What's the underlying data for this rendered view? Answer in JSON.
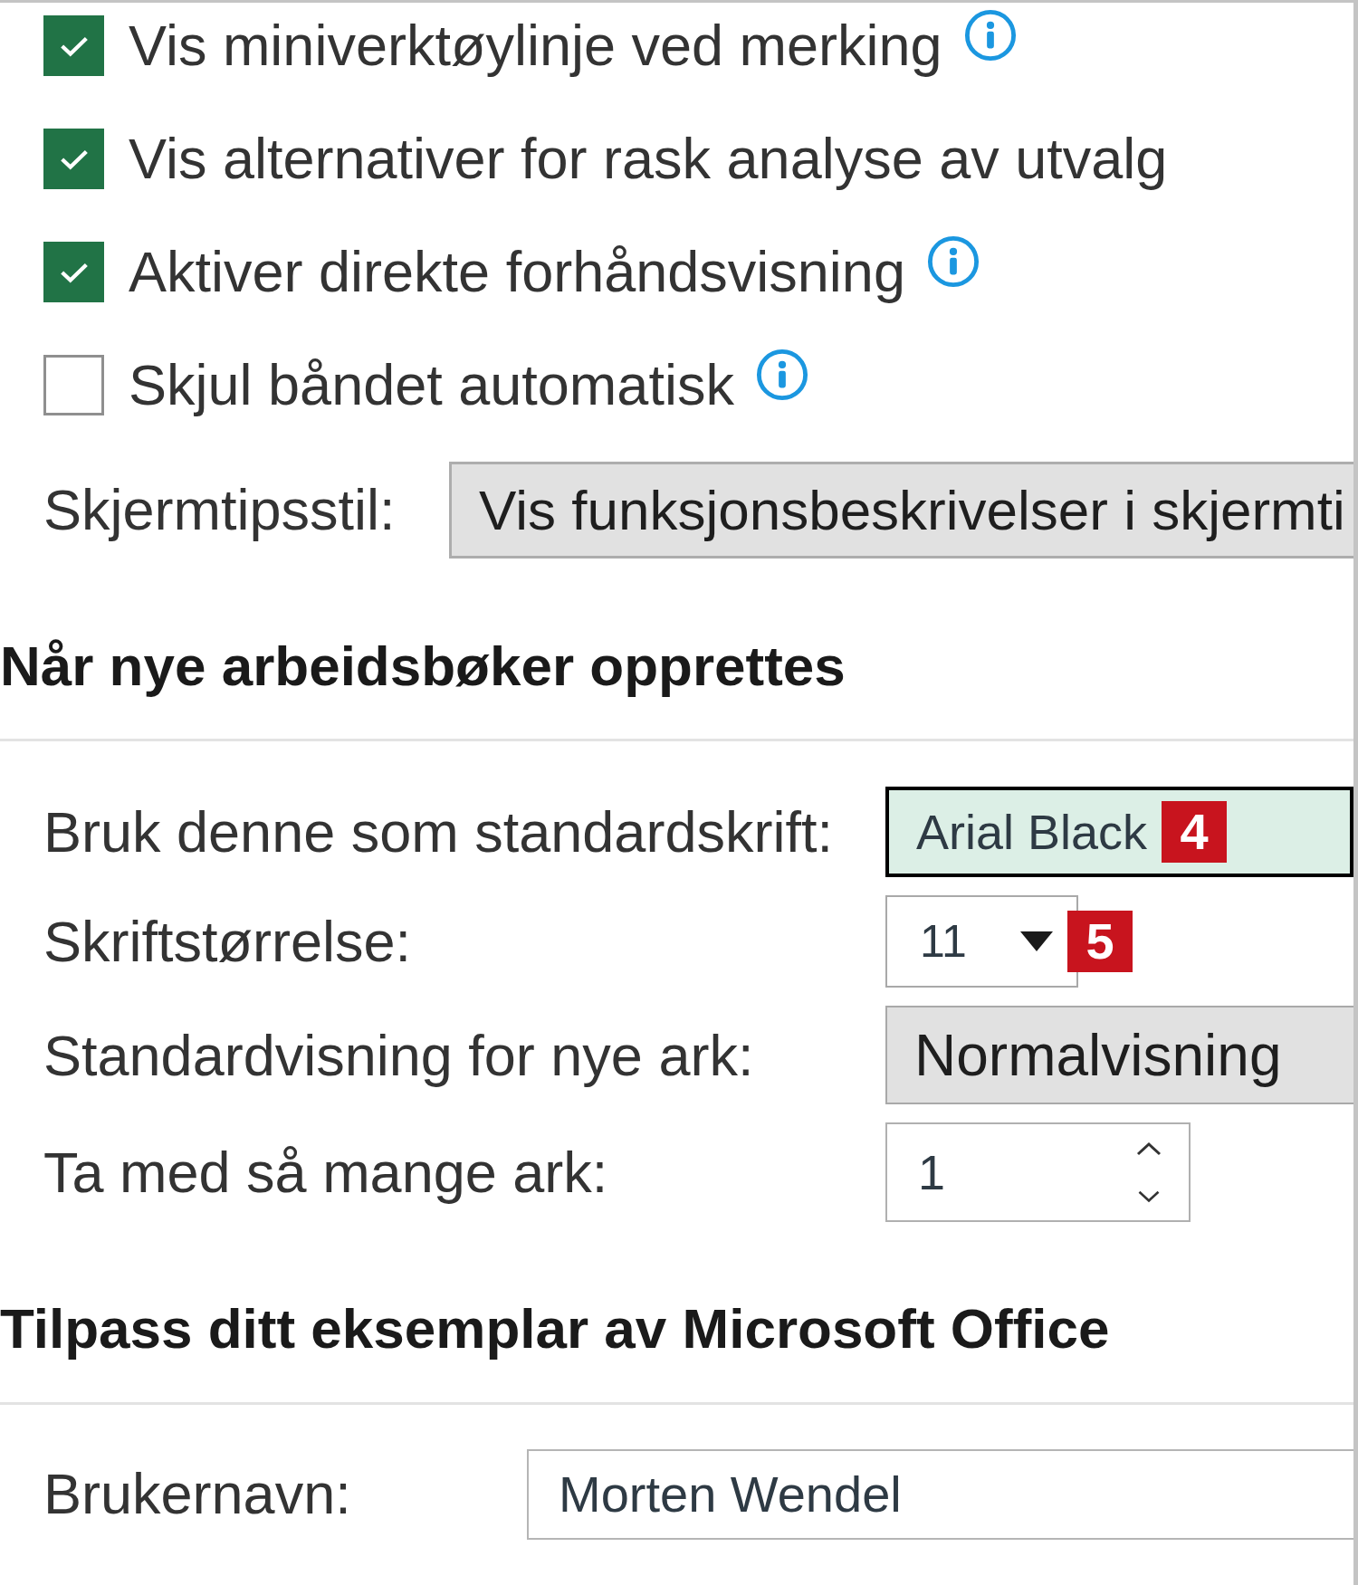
{
  "general_options": {
    "checkboxes": [
      {
        "label": "Vis miniverktøylinje ved merking",
        "checked": true,
        "info": true
      },
      {
        "label": "Vis alternativer for rask analyse av utvalg",
        "checked": true,
        "info": false
      },
      {
        "label": "Aktiver direkte forhåndsvisning",
        "checked": true,
        "info": true
      },
      {
        "label": "Skjul båndet automatisk",
        "checked": false,
        "info": true
      }
    ],
    "screentip_style": {
      "label": "Skjermtipsstil:",
      "value": "Vis funksjonsbeskrivelser i skjermti"
    }
  },
  "new_workbooks": {
    "heading": "Når nye arbeidsbøker opprettes",
    "fields": [
      {
        "kind": "combo",
        "label": "Bruk denne som standardskrift:",
        "value": "Arial Black",
        "focused": true,
        "badge": "4"
      },
      {
        "kind": "dropdown",
        "label": "Skriftstørrelse:",
        "value": "11",
        "badge": "5"
      },
      {
        "kind": "select",
        "label": "Standardvisning for nye ark:",
        "value": "Normalvisning"
      },
      {
        "kind": "spinner",
        "label": "Ta med så mange ark:",
        "value": "1"
      }
    ]
  },
  "personalize": {
    "heading": "Tilpass ditt eksemplar av Microsoft Office",
    "fields": [
      {
        "kind": "text",
        "label": "Brukernavn:",
        "value": "Morten Wendel"
      }
    ]
  }
}
